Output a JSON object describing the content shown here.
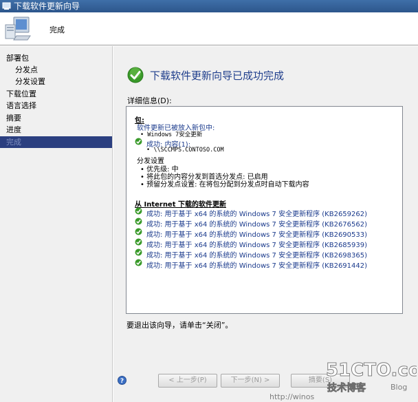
{
  "window": {
    "title": "下载软件更新向导"
  },
  "header": {
    "title": "完成",
    "icon": "computer-icon"
  },
  "sidebar": {
    "items": [
      {
        "label": "部署包",
        "sub": false,
        "active": false
      },
      {
        "label": "分发点",
        "sub": true,
        "active": false
      },
      {
        "label": "分发设置",
        "sub": true,
        "active": false
      },
      {
        "label": "下载位置",
        "sub": false,
        "active": false
      },
      {
        "label": "语言选择",
        "sub": false,
        "active": false
      },
      {
        "label": "摘要",
        "sub": false,
        "active": false
      },
      {
        "label": "进度",
        "sub": false,
        "active": false
      },
      {
        "label": "完成",
        "sub": false,
        "active": true
      }
    ]
  },
  "main": {
    "title": "下载软件更新向导已成功完成",
    "details_label": "详细信息(D):",
    "details": {
      "package_heading": "包:",
      "added_text": "软件更新已被放入新包中:",
      "package_name": "• Windows 7安全更新",
      "success_content": "成功: 内容(1):",
      "content_path": "• \\\\SCCMPS.CONTOSO.COM",
      "dist_settings": "分发设置",
      "priority": "• 优先级: 中",
      "distribute_line": "• 将此包的内容分发到首选分发点: 已启用",
      "prestage_line": "• 预留分发点设置: 在将包分配到分发点时自动下载内容",
      "internet_heading": "从 Internet 下载的软件更新",
      "updates": [
        "成功: 用于基于 x64 的系统的 Windows 7 安全更新程序 (KB2659262)",
        "成功: 用于基于 x64 的系统的 Windows 7 安全更新程序 (KB2676562)",
        "成功: 用于基于 x64 的系统的 Windows 7 安全更新程序 (KB2690533)",
        "成功: 用于基于 x64 的系统的 Windows 7 安全更新程序 (KB2685939)",
        "成功: 用于基于 x64 的系统的 Windows 7 安全更新程序 (KB2698365)",
        "成功: 用于基于 x64 的系统的 Windows 7 安全更新程序 (KB2691442)"
      ]
    },
    "exit_note": "要退出该向导，请单击“关闭”。"
  },
  "footer": {
    "prev_label": "< 上一步(P)",
    "next_label": "下一步(N) >",
    "summary_label": "摘要(S)",
    "help_icon": "help-icon"
  },
  "watermark": {
    "brand": "51CTO.com",
    "tagline": "技术博客",
    "blog": "Blog",
    "url": "http://winos"
  },
  "colors": {
    "title_blue": "#1f3e8c",
    "active_nav": "#2b3f80",
    "success_green": "#3a9a2a"
  }
}
